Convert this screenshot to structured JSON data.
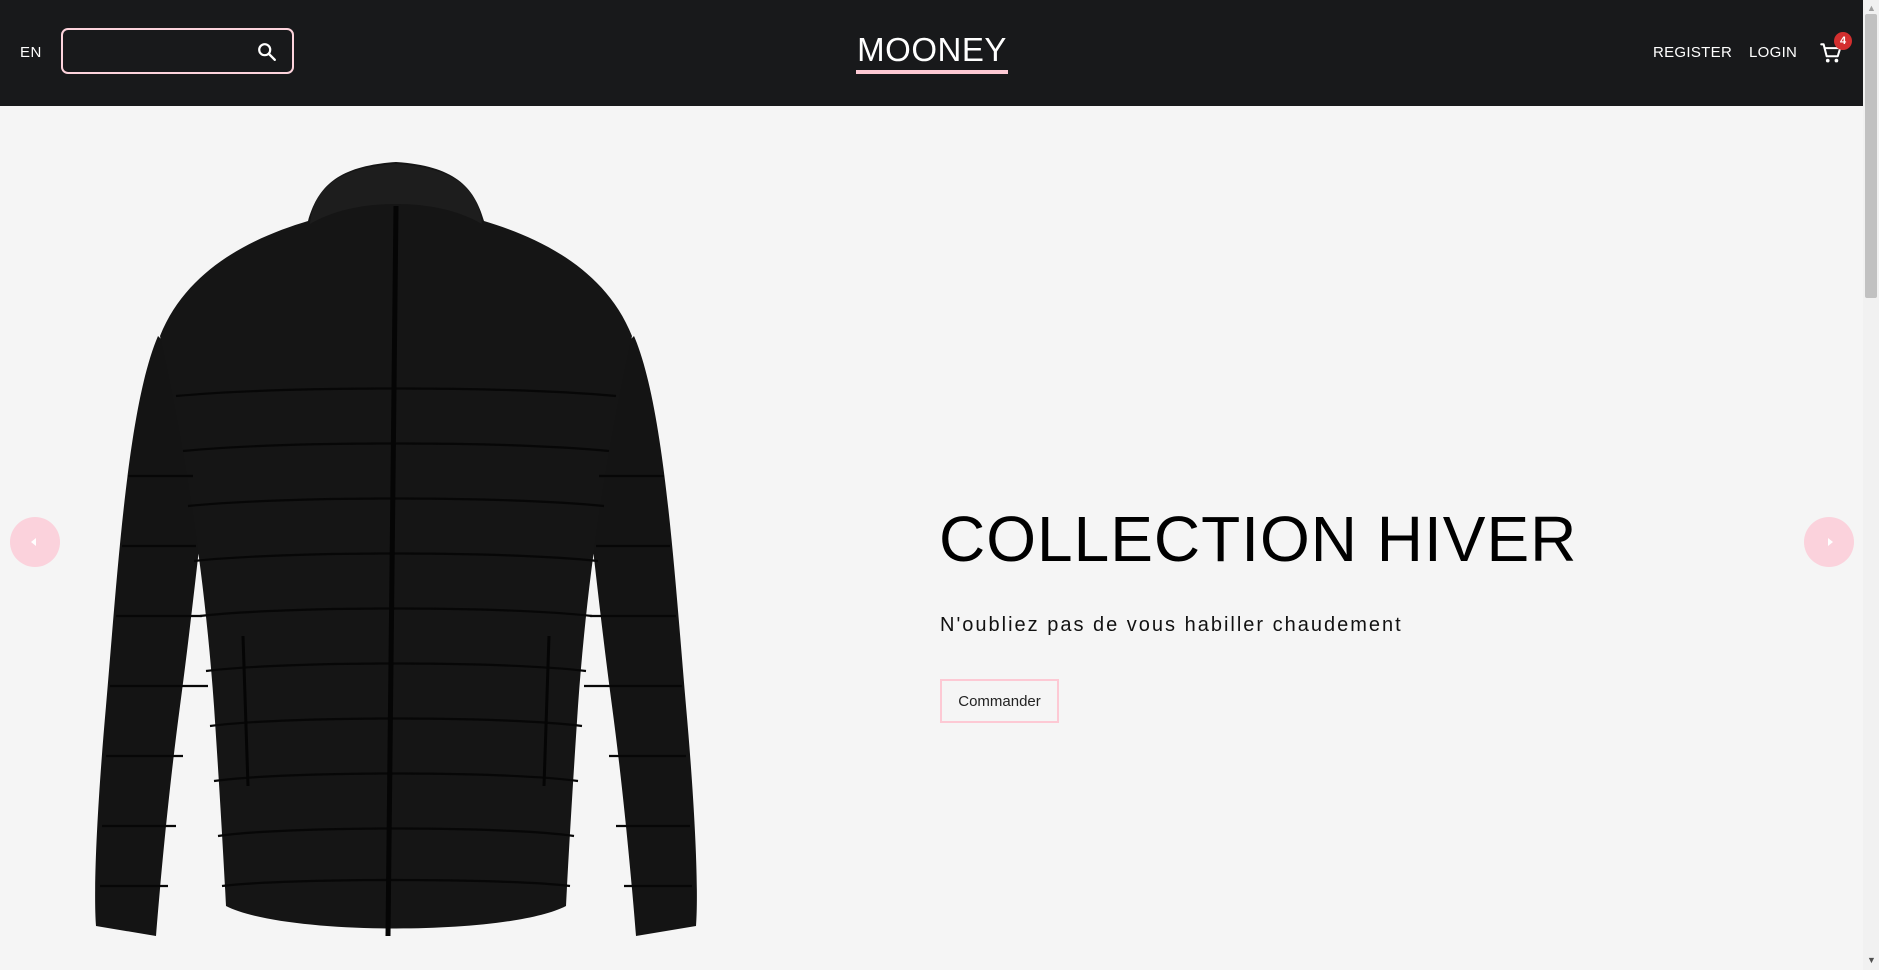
{
  "header": {
    "language": "EN",
    "search": {
      "value": "",
      "placeholder": ""
    },
    "logo": "MOONEY",
    "nav": {
      "register": "REGISTER",
      "login": "LOGIN"
    },
    "cart_count": "4"
  },
  "hero": {
    "title": "COLLECTION HIVER",
    "subtitle": "N'oubliez pas de vous habiller chaudement",
    "cta_label": "Commander"
  },
  "icons": {
    "search": "search-icon",
    "cart": "shopping-cart-icon",
    "prev": "caret-left-icon",
    "next": "caret-right-icon"
  },
  "colors": {
    "header_bg": "#18191b",
    "accent_pink": "#fdc9d4",
    "hero_bg": "#f5f5f5",
    "badge": "#d32f2f"
  }
}
